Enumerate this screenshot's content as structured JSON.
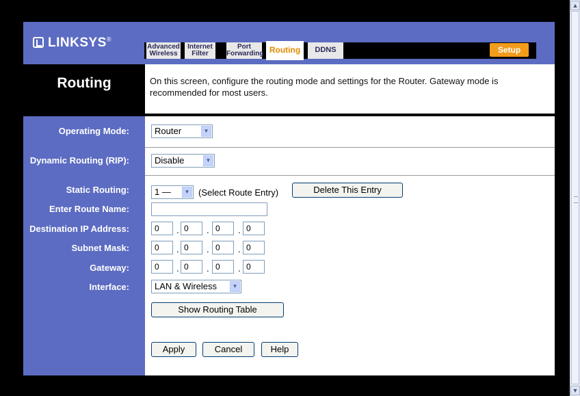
{
  "brand": {
    "logo_text": "LINKSYS"
  },
  "tabs": [
    {
      "label": "Advanced\nWireless"
    },
    {
      "label": "Internet\nFilter"
    },
    {
      "label": "Port\nForwarding"
    },
    {
      "label": "Routing"
    },
    {
      "label": "DDNS"
    }
  ],
  "setup_label": "Setup",
  "page_title": "Routing",
  "description": "On this screen, configure the routing mode and settings for the Router. Gateway mode is recommended for most users.",
  "form": {
    "operating_mode": {
      "label": "Operating Mode:",
      "value": "Router"
    },
    "dynamic_routing": {
      "label": "Dynamic Routing (RIP):",
      "value": "Disable"
    },
    "static_routing": {
      "label": "Static Routing:",
      "value": "1 —",
      "hint": "(Select Route Entry)",
      "delete_label": "Delete This Entry"
    },
    "route_name": {
      "label": "Enter Route Name:",
      "value": ""
    },
    "destination_ip": {
      "label": "Destination IP Address:",
      "octets": [
        "0",
        "0",
        "0",
        "0"
      ]
    },
    "subnet_mask": {
      "label": "Subnet Mask:",
      "octets": [
        "0",
        "0",
        "0",
        "0"
      ]
    },
    "gateway": {
      "label": "Gateway:",
      "octets": [
        "0",
        "0",
        "0",
        "0"
      ]
    },
    "interface": {
      "label": "Interface:",
      "value": "LAN & Wireless"
    },
    "show_table_label": "Show Routing Table"
  },
  "actions": {
    "apply": "Apply",
    "cancel": "Cancel",
    "help": "Help"
  },
  "colors": {
    "frame": "#5c6cc2",
    "active_tab": "#e08a00",
    "setup": "#f29c1c"
  }
}
